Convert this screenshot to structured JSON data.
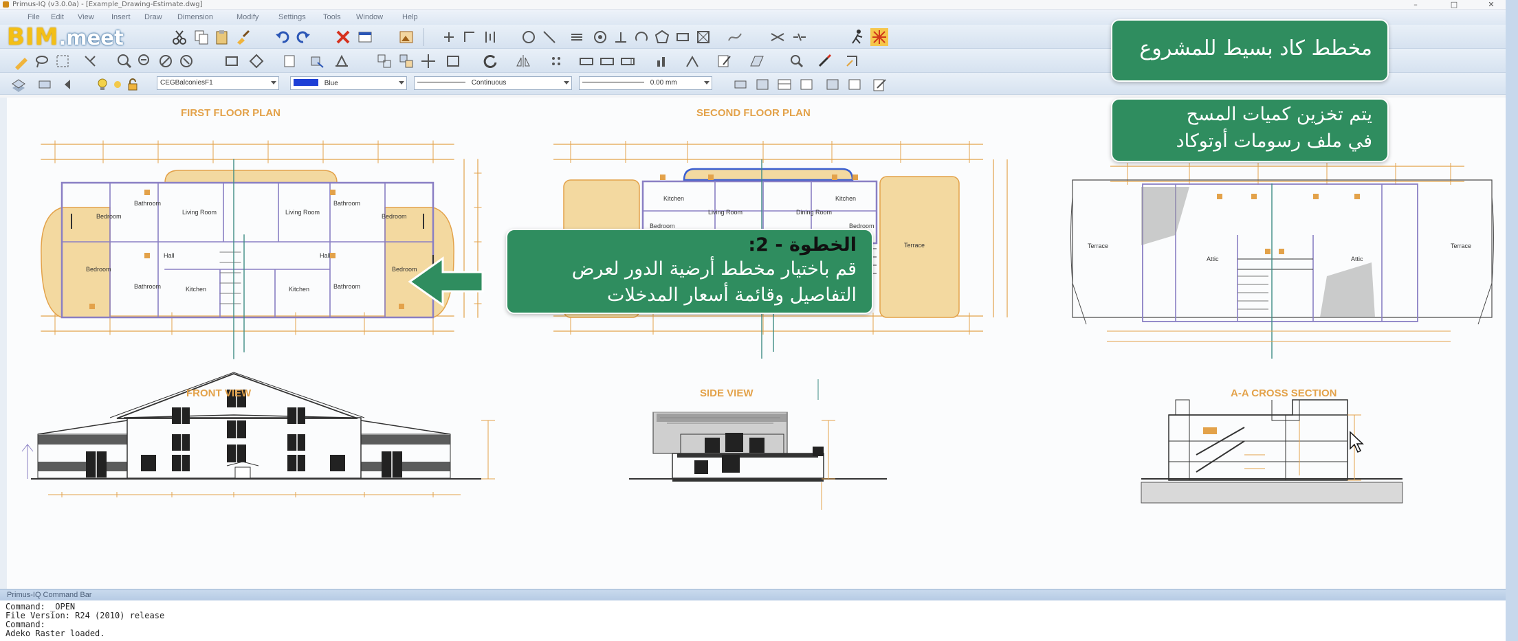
{
  "window": {
    "title": "Primus-IQ (v3.0.0a) - [Example_Drawing-Estimate.dwg]",
    "controls": [
      "–",
      "□",
      "✕"
    ]
  },
  "menu": [
    "File",
    "Edit",
    "View",
    "Insert",
    "Draw",
    "Dimension",
    "Modify",
    "Settings",
    "Tools",
    "Window",
    "Help"
  ],
  "logo": {
    "bim": "BIM",
    "meet": ".meet"
  },
  "properties": {
    "layer": "CEGBalconiesF1",
    "color": "Blue",
    "linetype": "Continuous",
    "lineweight": "0.00 mm"
  },
  "drawing": {
    "first_floor": {
      "title": "FIRST FLOOR PLAN",
      "rooms": [
        "Bedroom",
        "Bathroom",
        "Living Room",
        "Living Room",
        "Bathroom",
        "Bedroom",
        "Bedroom",
        "Hall",
        "Hall",
        "Bedroom",
        "Bathroom",
        "Kitchen",
        "Kitchen",
        "Bathroom"
      ]
    },
    "second_floor": {
      "title": "SECOND FLOOR PLAN",
      "rooms": [
        "Kitchen",
        "Living Room",
        "Dining Room",
        "Kitchen",
        "Bedroom",
        "Bedroom",
        "Terrace"
      ]
    },
    "third_plan": {
      "rooms": [
        "Terrace",
        "Attic",
        "Attic",
        "Terrace"
      ]
    },
    "front_view": "FRONT VIEW",
    "side_view": "SIDE VIEW",
    "cross_section": "A-A CROSS SECTION"
  },
  "command_bar": {
    "title": "Primus-IQ Command Bar",
    "lines": [
      "Command: _OPEN",
      "File Version: R24 (2010) release",
      "Command:",
      "Adeko Raster loaded."
    ]
  },
  "callouts": {
    "simple_plan": "مخطط كاد بسيط للمشروع",
    "storage": [
      "يتم تخزين كميات المسح",
      "في ملف رسومات أوتوكاد"
    ],
    "step": {
      "heading": "الخطوة - 2:",
      "lines": [
        "قم باختيار مخطط أرضية الدور لعرض",
        "التفاصيل وقائمة أسعار المدخلات"
      ]
    }
  },
  "colors": {
    "callout_green": "#2f8d5f",
    "cad_orange": "#e3a24a",
    "cad_purple": "#8a7fc4",
    "cad_fill": "#f3d9a0",
    "logo_yellow": "#f3bf16"
  },
  "icons": [
    "cut-icon",
    "copy-icon",
    "paste-icon",
    "undo-icon",
    "redo-icon",
    "delete-icon",
    "line-icon",
    "circle-icon",
    "arc-icon",
    "rectangle-icon",
    "polygon-icon",
    "zoom-icon",
    "pan-icon",
    "hatch-icon",
    "text-icon",
    "layer-icon"
  ]
}
